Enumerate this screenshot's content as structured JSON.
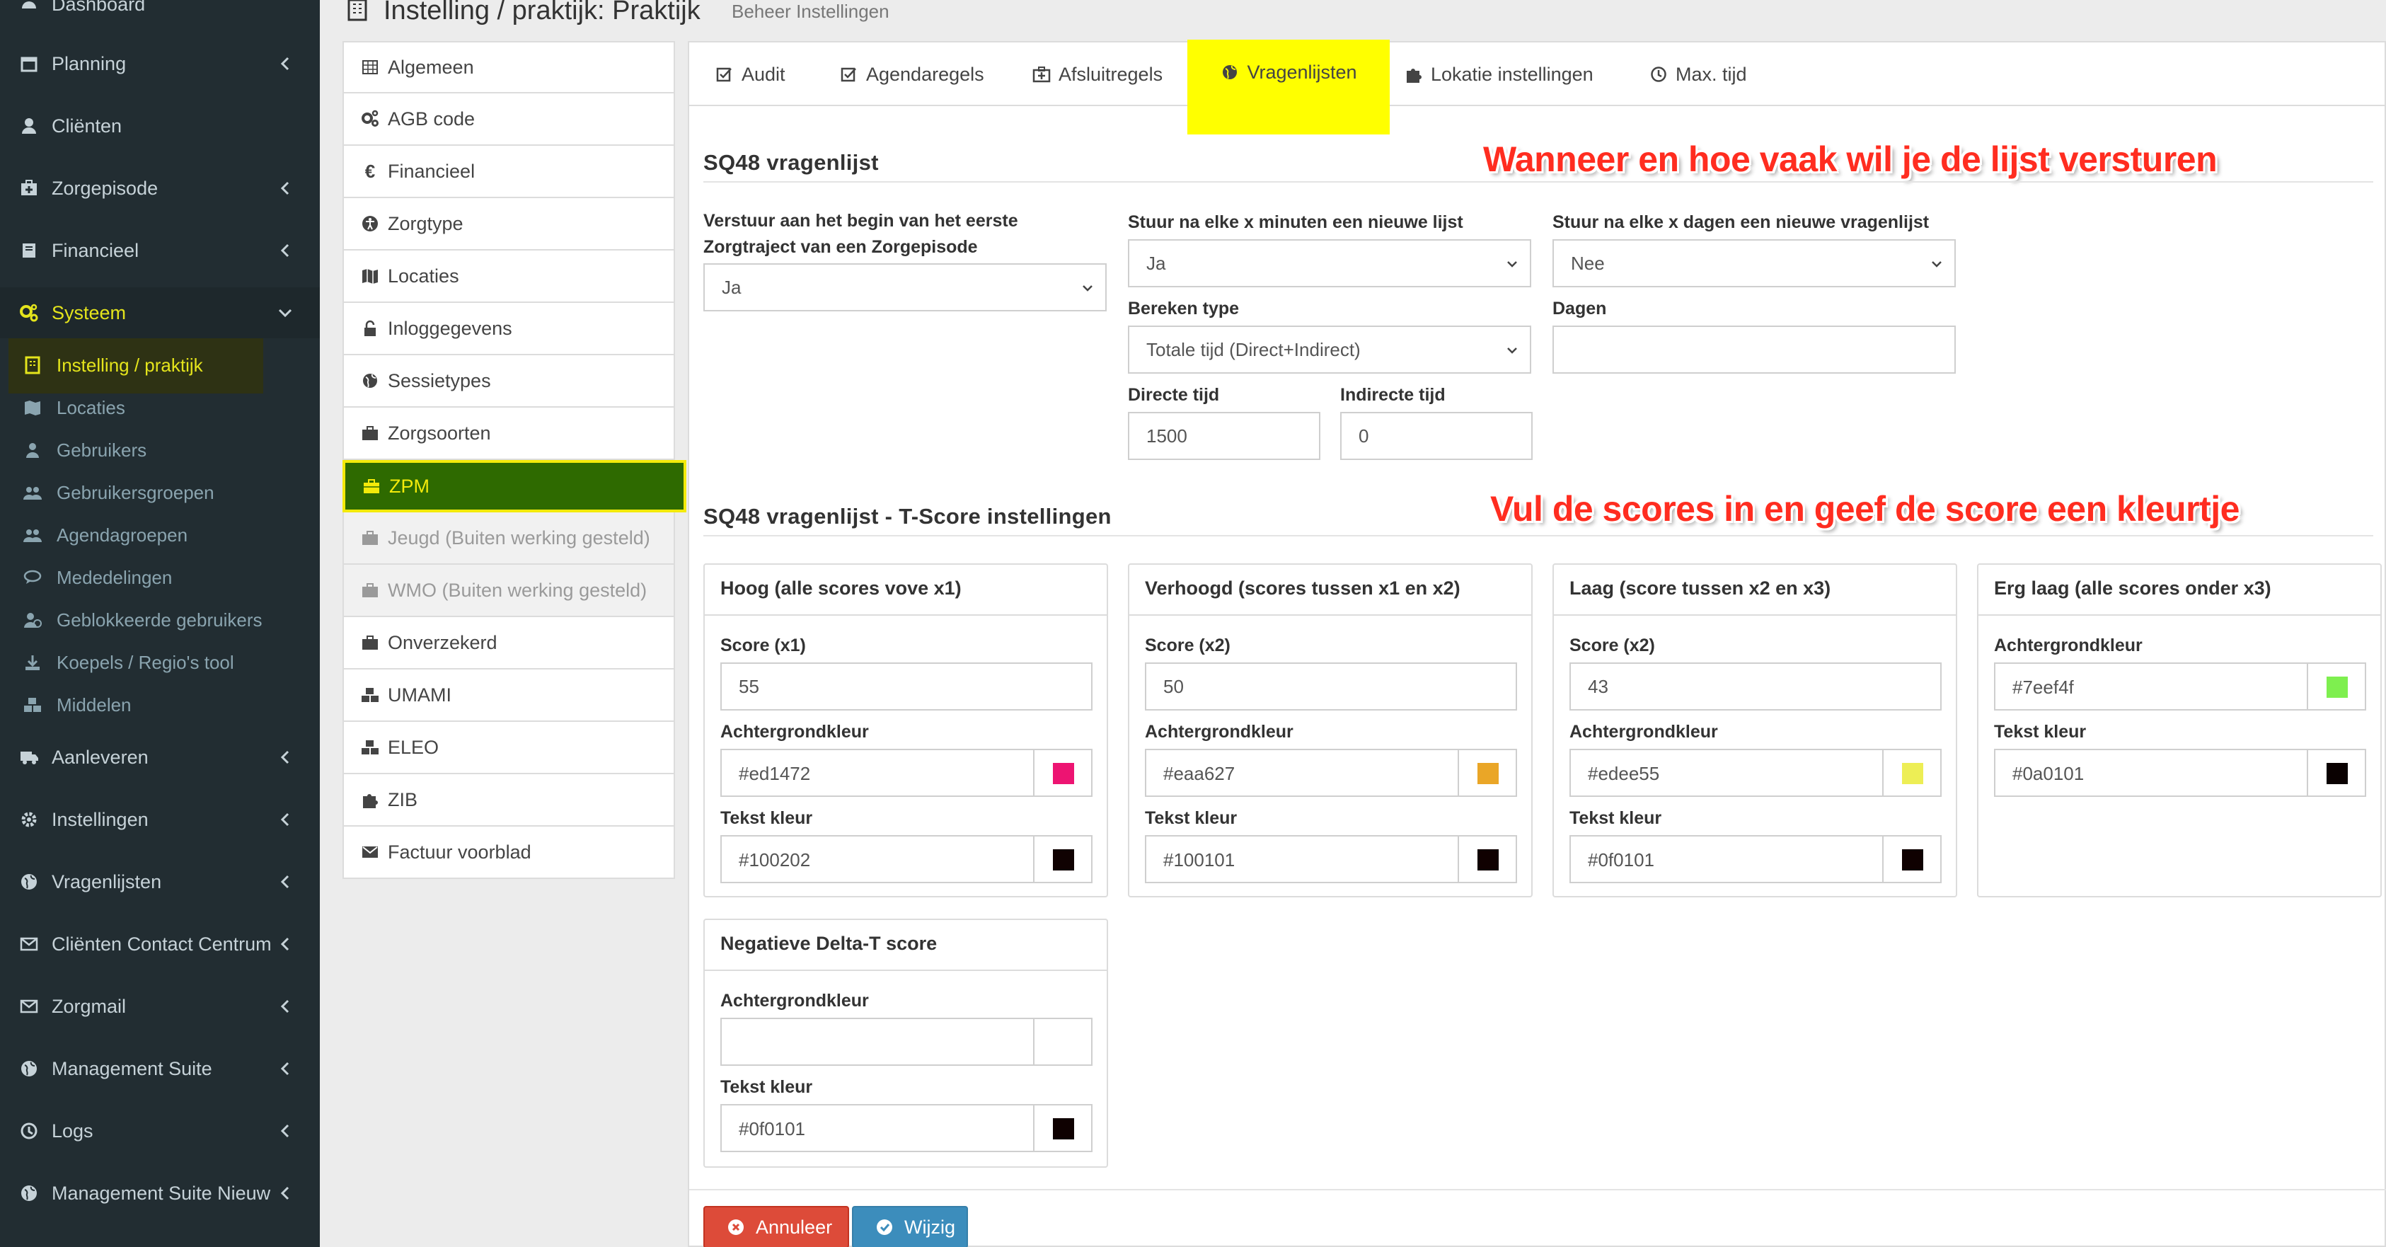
{
  "sidebar": {
    "items": [
      {
        "label": "Dashboard",
        "icon": "dashboard-icon"
      },
      {
        "label": "Planning",
        "icon": "calendar-icon"
      },
      {
        "label": "Cliënten",
        "icon": "user-icon"
      },
      {
        "label": "Zorgepisode",
        "icon": "medkit-icon"
      },
      {
        "label": "Financieel",
        "icon": "book-icon"
      },
      {
        "label": "Systeem",
        "icon": "cogs-icon"
      },
      {
        "label": "Aanleveren",
        "icon": "truck-icon"
      },
      {
        "label": "Instellingen",
        "icon": "gear-icon"
      },
      {
        "label": "Vragenlijsten",
        "icon": "globe-icon"
      },
      {
        "label": "Cliënten Contact Centrum",
        "icon": "envelope-icon"
      },
      {
        "label": "Zorgmail",
        "icon": "envelope-icon"
      },
      {
        "label": "Management Suite",
        "icon": "globe-icon"
      },
      {
        "label": "Logs",
        "icon": "clock-icon"
      },
      {
        "label": "Management Suite Nieuw",
        "icon": "globe-icon"
      }
    ],
    "sub_items": [
      {
        "label": "Instelling / praktijk",
        "icon": "building-icon"
      },
      {
        "label": "Locaties",
        "icon": "map-icon"
      },
      {
        "label": "Gebruikers",
        "icon": "user-icon"
      },
      {
        "label": "Gebruikersgroepen",
        "icon": "users-icon"
      },
      {
        "label": "Agendagroepen",
        "icon": "users-icon"
      },
      {
        "label": "Mededelingen",
        "icon": "comment-icon"
      },
      {
        "label": "Geblokkeerde gebruikers",
        "icon": "user-block-icon"
      },
      {
        "label": "Koepels / Regio's tool",
        "icon": "download-icon"
      },
      {
        "label": "Middelen",
        "icon": "cubes-icon"
      }
    ]
  },
  "header": {
    "title": "Instelling / praktijk: Praktijk",
    "subtitle": "Beheer Instellingen"
  },
  "left_menu": [
    {
      "label": "Algemeen",
      "icon": "table-icon"
    },
    {
      "label": "AGB code",
      "icon": "cogs-icon"
    },
    {
      "label": "Financieel",
      "icon": "euro-icon"
    },
    {
      "label": "Zorgtype",
      "icon": "accessibility-icon"
    },
    {
      "label": "Locaties",
      "icon": "map-icon"
    },
    {
      "label": "Inloggegevens",
      "icon": "lock-icon"
    },
    {
      "label": "Sessietypes",
      "icon": "globe-icon"
    },
    {
      "label": "Zorgsoorten",
      "icon": "briefcase-icon"
    },
    {
      "label": "ZPM",
      "icon": "briefcase-icon"
    },
    {
      "label": "Jeugd (Buiten werking gesteld)",
      "icon": "briefcase-icon"
    },
    {
      "label": "WMO (Buiten werking gesteld)",
      "icon": "briefcase-icon"
    },
    {
      "label": "Onverzekerd",
      "icon": "briefcase-icon"
    },
    {
      "label": "UMAMI",
      "icon": "cubes-icon"
    },
    {
      "label": "ELEO",
      "icon": "cubes-icon"
    },
    {
      "label": "ZIB",
      "icon": "puzzle-icon"
    },
    {
      "label": "Factuur voorblad",
      "icon": "envelope-icon"
    }
  ],
  "tabs": [
    {
      "label": "Audit",
      "icon": "check-square-icon"
    },
    {
      "label": "Agendaregels",
      "icon": "check-square-icon"
    },
    {
      "label": "Afsluitregels",
      "icon": "medkit-icon"
    },
    {
      "label": "Vragenlijsten",
      "icon": "globe-icon"
    },
    {
      "label": "Lokatie instellingen",
      "icon": "puzzle-icon"
    },
    {
      "label": "Max. tijd",
      "icon": "clock-icon"
    }
  ],
  "sq48": {
    "title": "SQ48 vragenlijst",
    "send_start_label": "Verstuur aan het begin van het eerste Zorgtraject van een Zorgepisode",
    "send_start_value": "Ja",
    "every_minutes_label": "Stuur na elke x minuten een nieuwe lijst",
    "every_minutes_value": "Ja",
    "every_days_label": "Stuur na elke x dagen een nieuwe vragenlijst",
    "every_days_value": "Nee",
    "calc_type_label": "Bereken type",
    "calc_type_value": "Totale tijd (Direct+Indirect)",
    "days_label": "Dagen",
    "days_value": "",
    "direct_label": "Directe tijd",
    "direct_value": "1500",
    "indirect_label": "Indirecte tijd",
    "indirect_value": "0"
  },
  "annotations": {
    "top": "Wanneer en hoe vaak wil je de lijst versturen",
    "bottom": "Vul de scores in en geef de score een kleurtje"
  },
  "tscore": {
    "title": "SQ48 vragenlijst - T-Score instellingen",
    "cards": [
      {
        "title": "Hoog (alle scores vove x1)",
        "score_label": "Score (x1)",
        "score": "55",
        "bg_label": "Achtergrondkleur",
        "bg": "#ed1472",
        "text_label": "Tekst kleur",
        "text": "#100202"
      },
      {
        "title": "Verhoogd (scores tussen x1 en x2)",
        "score_label": "Score (x2)",
        "score": "50",
        "bg_label": "Achtergrondkleur",
        "bg": "#eaa627",
        "text_label": "Tekst kleur",
        "text": "#100101"
      },
      {
        "title": "Laag (score tussen x2 en x3)",
        "score_label": "Score (x2)",
        "score": "43",
        "bg_label": "Achtergrondkleur",
        "bg": "#edee55",
        "text_label": "Tekst kleur",
        "text": "#0f0101"
      },
      {
        "title": "Erg laag (alle scores onder x3)",
        "bg_label": "Achtergrondkleur",
        "bg": "#7eef4f",
        "text_label": "Tekst kleur",
        "text": "#0a0101"
      }
    ],
    "delta": {
      "title": "Negatieve Delta-T score",
      "bg_label": "Achtergrondkleur",
      "bg": "",
      "text_label": "Tekst kleur",
      "text": "#0f0101"
    }
  },
  "buttons": {
    "cancel": "Annuleer",
    "save": "Wijzig"
  },
  "colors": {
    "sidebar_bg": "#222d32",
    "active_yellow": "#e4e41c",
    "zpm_green": "#2e6a00",
    "annotation_red": "#ff2d20",
    "cancel_red": "#dd4b39",
    "save_blue": "#3c8dbc"
  }
}
